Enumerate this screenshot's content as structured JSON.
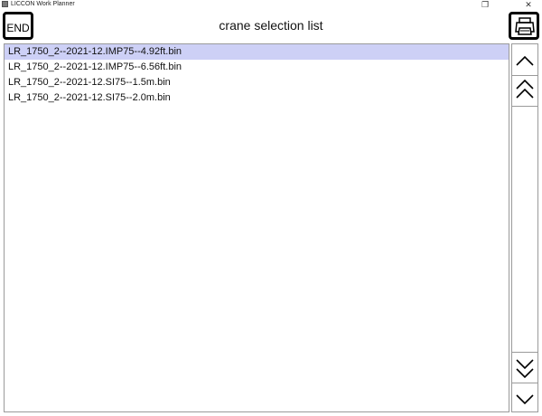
{
  "window": {
    "title": "LICCON Work Planner",
    "min_glyph": "",
    "max_glyph": "❐",
    "close_glyph": "✕"
  },
  "header": {
    "end_label": "END",
    "title": "crane selection list",
    "print_icon": "printer-icon"
  },
  "list": {
    "items": [
      "LR_1750_2--2021-12.IMP75--4.92ft.bin",
      "LR_1750_2--2021-12.IMP75--6.56ft.bin",
      "LR_1750_2--2021-12.SI75--1.5m.bin",
      "LR_1750_2--2021-12.SI75--2.0m.bin"
    ],
    "selected_index": 0,
    "selected_color": "#cdd0f6"
  },
  "scroll": {
    "icons": [
      "chevron-up-icon",
      "double-chevron-up-icon",
      "double-chevron-down-icon",
      "chevron-down-icon"
    ]
  }
}
